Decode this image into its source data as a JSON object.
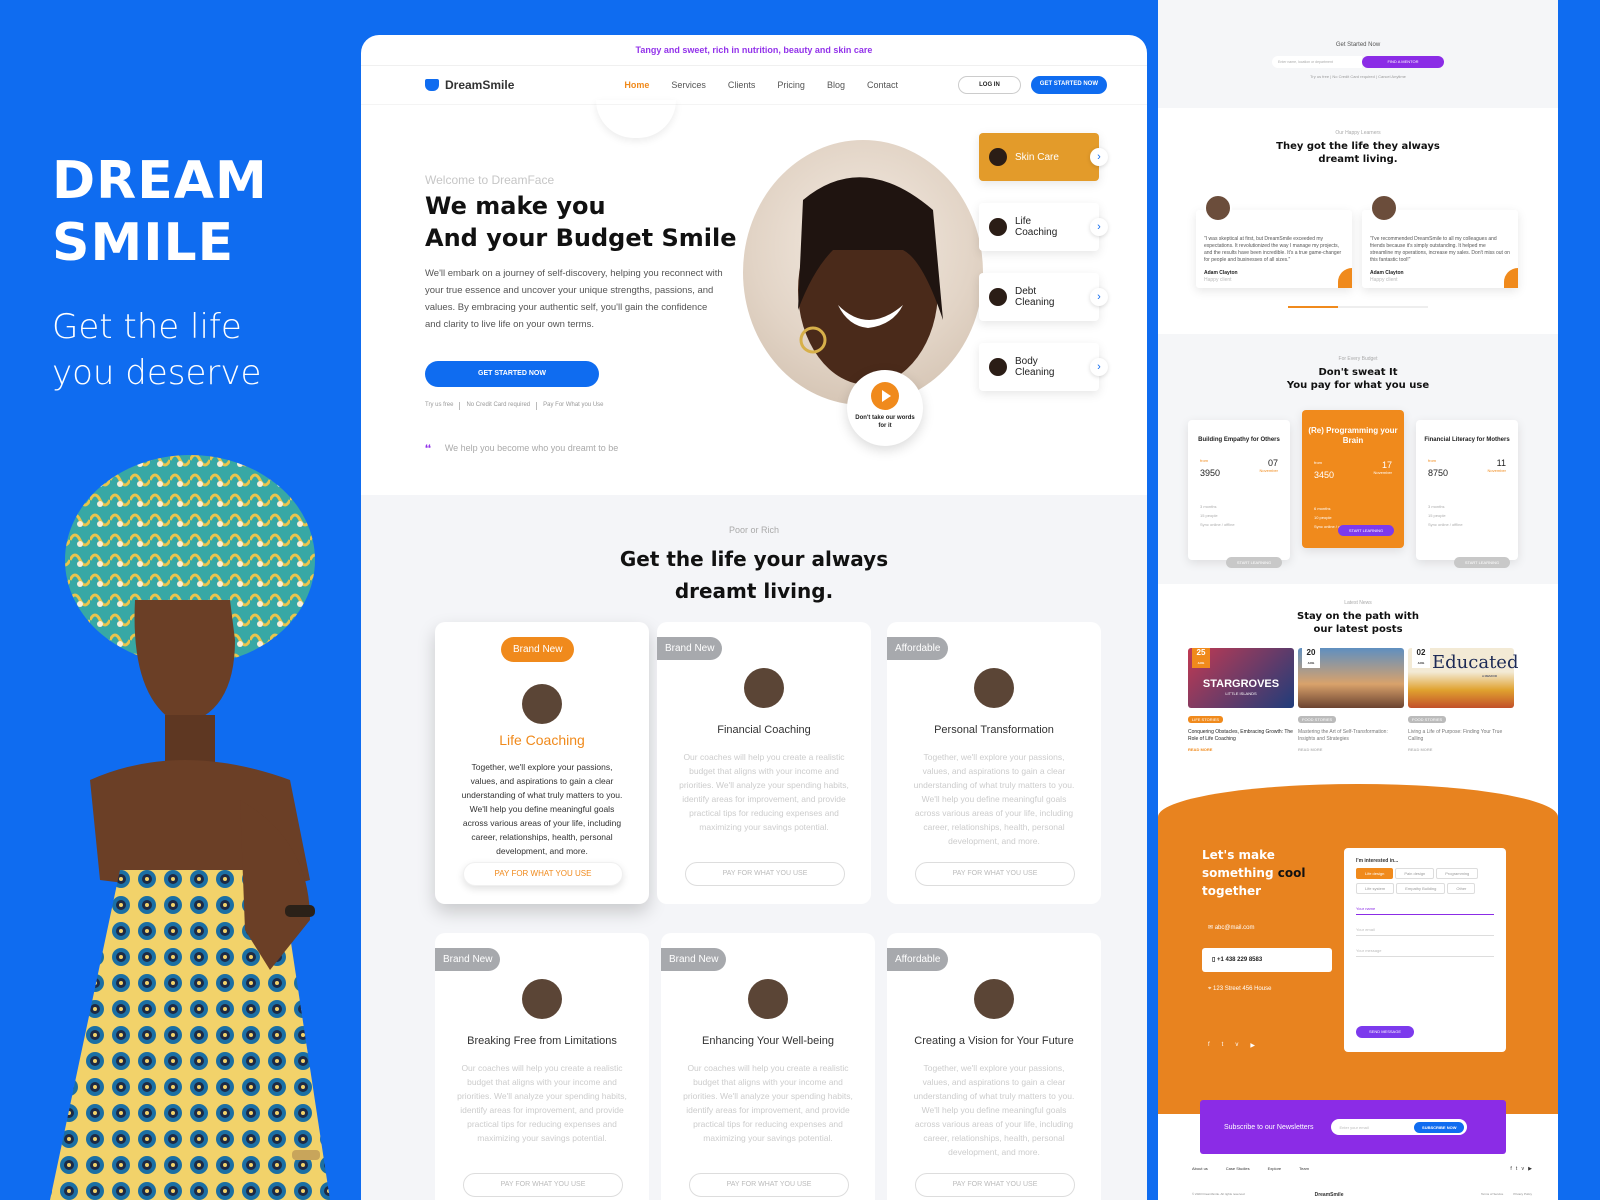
{
  "brand": {
    "title_line1": "DREAM",
    "title_line2": "SMILE",
    "tagline_line1": "Get the life",
    "tagline_line2": "you deserve"
  },
  "mock": {
    "promo": "Tangy and sweet, rich in nutrition, beauty and skin care",
    "logo": "DreamSmile",
    "nav": [
      "Home",
      "Services",
      "Clients",
      "Pricing",
      "Blog",
      "Contact"
    ],
    "login": "LOG IN",
    "get_started": "GET STARTED NOW",
    "hero": {
      "welcome": "Welcome to DreamFace",
      "headline_line1": "We make you",
      "headline_line2": "And your Budget Smile",
      "description": "We'll embark on a journey of self-discovery, helping you reconnect with your true essence and uncover your unique strengths, passions, and values. By embracing your authentic self, you'll gain the confidence and clarity to live life on your own terms.",
      "cta": "GET STARTED NOW",
      "trial": [
        "Try us free",
        "No Credit Card required",
        "Pay For What you Use"
      ],
      "help": "We help you become who you dreamt to be",
      "play_caption": "Don't take our words for it"
    },
    "services": [
      {
        "label": "Skin Care",
        "active": true
      },
      {
        "label": "Life Coaching",
        "active": false
      },
      {
        "label": "Debt Cleaning",
        "active": false
      },
      {
        "label": "Body Cleaning",
        "active": false
      }
    ],
    "section": {
      "eyebrow": "Poor or Rich",
      "title_line1": "Get the life your always",
      "title_line2": "dreamt living."
    },
    "cards": [
      {
        "badge": "Brand New",
        "name": "Life Coaching",
        "body": "Together, we'll explore your passions, values, and aspirations to gain a clear understanding of what truly matters to you. We'll help you define meaningful goals across various areas of your life, including career, relationships, health, personal development, and more.",
        "cta": "PAY FOR WHAT YOU USE"
      },
      {
        "badge": "Brand New",
        "name": "Financial Coaching",
        "body": "Our coaches will help you create a realistic budget that aligns with your income and priorities. We'll analyze your spending habits, identify areas for improvement, and provide practical tips for reducing expenses and maximizing your savings potential.",
        "cta": "PAY FOR WHAT YOU USE"
      },
      {
        "badge": "Affordable",
        "name": "Personal Transformation",
        "body": "Together, we'll explore your passions, values, and aspirations to gain a clear understanding of what truly matters to you. We'll help you define meaningful goals across various areas of your life, including career, relationships, health, personal development, and more.",
        "cta": "PAY FOR WHAT YOU USE"
      },
      {
        "badge": "Brand New",
        "name": "Breaking Free from Limitations",
        "body": "Our coaches will help you create a realistic budget that aligns with your income and priorities. We'll analyze your spending habits, identify areas for improvement, and provide practical tips for reducing expenses and maximizing your savings potential.",
        "cta": "PAY FOR WHAT YOU USE"
      },
      {
        "badge": "Brand New",
        "name": "Enhancing Your Well-being",
        "body": "Our coaches will help you create a realistic budget that aligns with your income and priorities. We'll analyze your spending habits, identify areas for improvement, and provide practical tips for reducing expenses and maximizing your savings potential.",
        "cta": "PAY FOR WHAT YOU USE"
      },
      {
        "badge": "Affordable",
        "name": "Creating a Vision for Your Future",
        "body": "Together, we'll explore your passions, values, and aspirations to gain a clear understanding of what truly matters to you. We'll help you define meaningful goals across various areas of your life, including career, relationships, health, personal development, and more.",
        "cta": "PAY FOR WHAT YOU USE"
      }
    ]
  },
  "side": {
    "get_started": "Get Started Now",
    "search_placeholder": "Enter name, location or department",
    "find_mentor": "FIND A MENTOR",
    "trial": [
      "Try us free",
      "No Credit Card required",
      "Cancel Anytime"
    ],
    "learners_eyebrow": "Our Happy Learners",
    "learners_title": "They got the life they always dreamt living.",
    "testimonials": [
      {
        "text": "\"I was skeptical at first, but DreamSmile exceeded my expectations. It revolutionized the way I manage my projects, and the results have been incredible. It's a true game-changer for people and businesses of all sizes.\"",
        "name": "Adam Clayton",
        "role": "Happy client"
      },
      {
        "text": "\"I've recommended DreamSmile to all my colleagues and friends because it's simply outstanding. It helped me streamline my operations, increase my sales. Don't miss out on this fantastic tool!\"",
        "name": "Adam Clayton",
        "role": "Happy client"
      }
    ],
    "budget_eyebrow": "For Every Budget",
    "budget_title_line1": "Don't sweat It",
    "budget_title_line2": "You pay for what you use",
    "plans": [
      {
        "title": "Building Empathy for Others",
        "from": "from",
        "price": "3950",
        "day": "07",
        "month": "November",
        "features": [
          "3 months",
          "15 people",
          "Sync online / offline"
        ],
        "cta": "START LEARNING"
      },
      {
        "title": "(Re) Programming your Brain",
        "from": "from",
        "price": "3450",
        "day": "17",
        "month": "November",
        "features": [
          "6 months",
          "10 people",
          "Sync online / offline"
        ],
        "cta": "START LEARNING"
      },
      {
        "title": "Financial Literacy for Mothers",
        "from": "from",
        "price": "8750",
        "day": "11",
        "month": "November",
        "features": [
          "3 months",
          "15 people",
          "Sync online / offline"
        ],
        "cta": "START LEARNING"
      }
    ],
    "news_eyebrow": "Latest News",
    "news_title_line1": "Stay on the path with",
    "news_title_line2": "our latest posts",
    "posts": [
      {
        "day": "25",
        "month": "AUG",
        "image_text": "STARGROVES",
        "image_sub": "LITTLE ISLANDS",
        "tag": "LIFE STORIES",
        "title": "Conquering Obstacles, Embracing Growth: The Role of Life Coaching",
        "more": "READ MORE"
      },
      {
        "day": "20",
        "month": "AUG",
        "tag": "FOOD STORIES",
        "title": "Mastering the Art of Self-Transformation: Insights and Strategies",
        "more": "READ MORE"
      },
      {
        "day": "02",
        "month": "AUG",
        "image_text": "Educated",
        "image_sub": "A MEMOIR",
        "tag": "FOOD STORIES",
        "title": "Living a Life of Purpose: Finding Your True Calling",
        "more": "READ MORE"
      }
    ],
    "contact": {
      "title_line1": "Let's make",
      "title_line2a": "something",
      "title_line2b": "cool",
      "title_line3": "together",
      "email": "abc@mail.com",
      "phone": "+1 438 229 8583",
      "address": "123 Street 456 House"
    },
    "form": {
      "interested": "I'm interested in...",
      "chips": [
        "Life design",
        "Pain design",
        "Programming",
        "Life system",
        "Empathy Building",
        "Other"
      ],
      "name": "Your name",
      "email": "Your email",
      "message": "Your message",
      "send": "SEND MESSAGE"
    },
    "newsletter": {
      "label": "Subscribe to our Newsletters",
      "placeholder": "Enter your email",
      "button": "SUBSCRIBE NOW"
    },
    "footer": {
      "links": [
        "About us",
        "Case Studies",
        "Explore",
        "Team"
      ],
      "copyright": "© 2023 DreamSmile. All rights reserved",
      "logo": "DreamSmile",
      "legal": [
        "Terms of Service",
        "Privacy Policy"
      ]
    }
  }
}
